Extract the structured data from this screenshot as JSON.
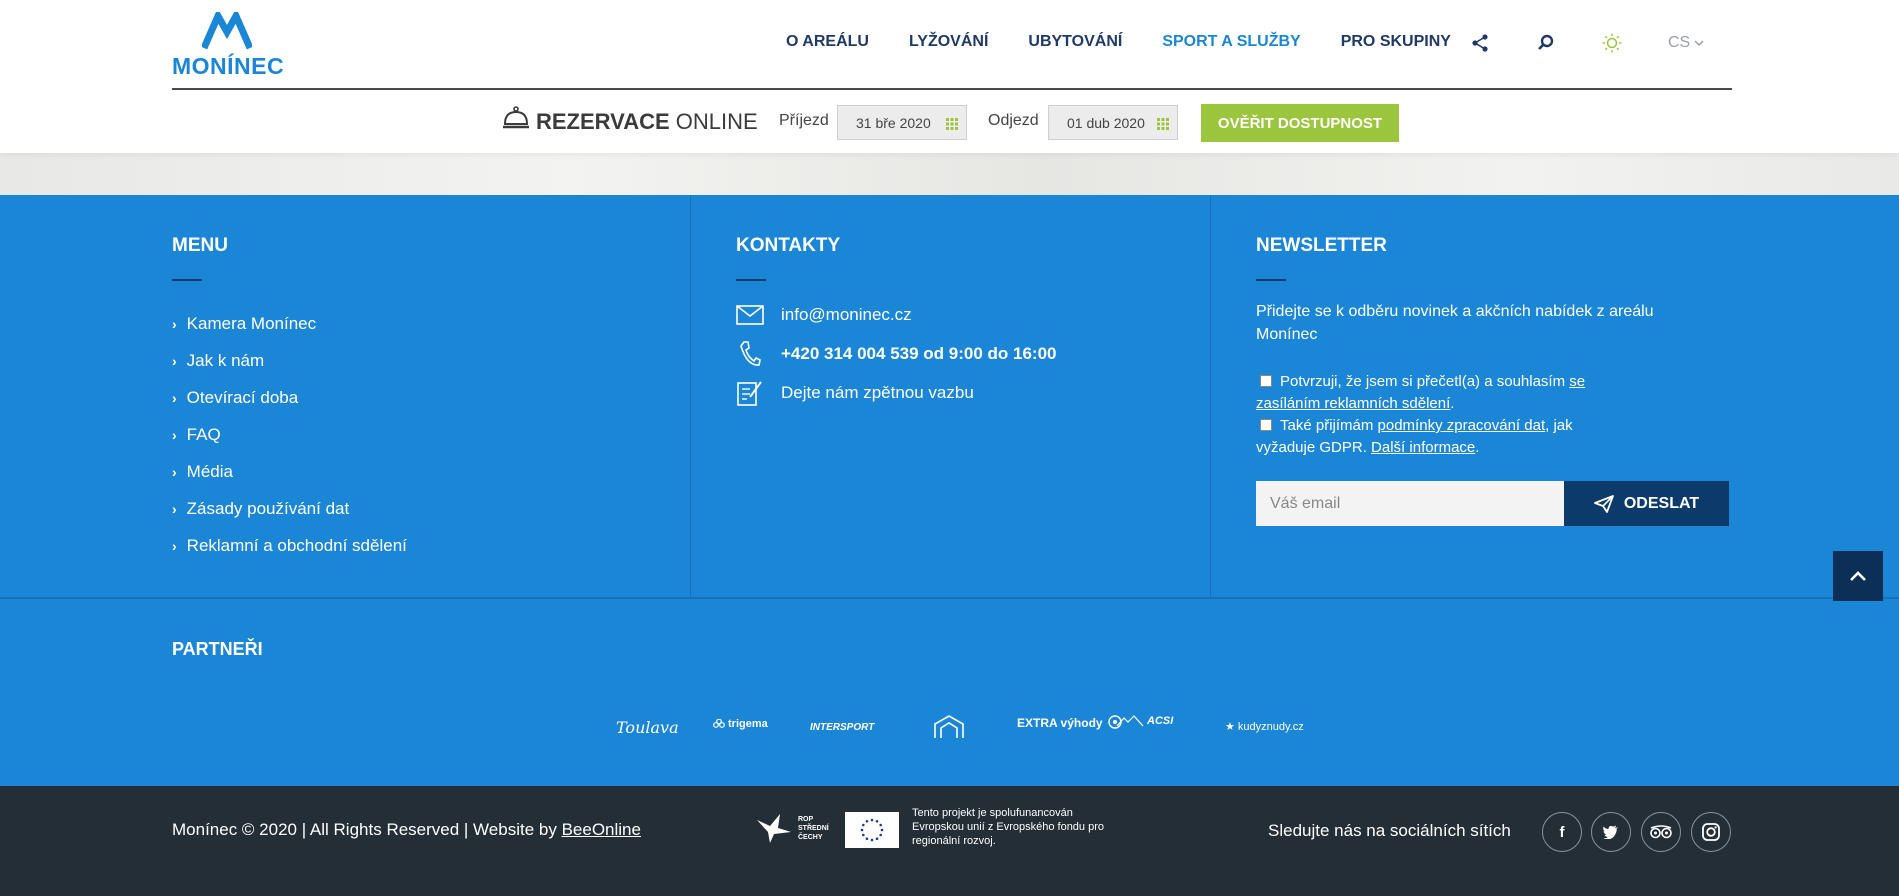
{
  "header": {
    "logo_text": "MONÍNEC",
    "nav": [
      "O AREÁLU",
      "LYŽOVÁNÍ",
      "UBYTOVÁNÍ",
      "SPORT A SLUŽBY",
      "PRO SKUPINY"
    ],
    "active_nav": "SPORT A SLUŽBY",
    "icons": [
      "share-icon",
      "search-icon",
      "sun-icon"
    ],
    "language": "CS"
  },
  "booking": {
    "title_bold": "REZERVACE",
    "title_light": "ONLINE",
    "arrival_label": "Příjezd",
    "arrival_value": "31 bře 2020",
    "departure_label": "Odjezd",
    "departure_value": "01 dub 2020",
    "check_button": "OVĚŘIT DOSTUPNOST"
  },
  "menu": {
    "title": "MENU",
    "items": [
      "Kamera Monínec",
      "Jak k nám",
      "Otevírací doba",
      "FAQ",
      "Média",
      "Zásady používání dat",
      "Reklamní a obchodní sdělení"
    ]
  },
  "contacts": {
    "title": "KONTAKTY",
    "email": "info@moninec.cz",
    "phone": "+420 314 004 539 od 9:00 do 16:00",
    "feedback": "Dejte nám zpětnou vazbu"
  },
  "newsletter": {
    "title": "NEWSLETTER",
    "intro": "Přidejte se k odběru novinek a akčních nabídek z areálu Monínec",
    "consent1_a": "Potvrzuji, že jsem si přečetl(a) a souhlasím",
    "consent1_link": "se zasíláním reklamních sdělení",
    "consent2_a": "Také přijímám",
    "consent2_link": "podmínky zpracování dat",
    "consent2_b": "jak vyžaduje GDPR.",
    "consent2_more": "Další informace",
    "email_placeholder": "Váš email",
    "send_button": "ODESLAT"
  },
  "partners": {
    "title": "PARTNEŘI",
    "items": [
      "Toulava",
      "trigema",
      "INTERSPORT",
      "",
      "EXTRA výhody",
      "ACSI",
      "kudyznudy.cz"
    ]
  },
  "bottom": {
    "copyright": "Monínec © 2020 | All Rights Reserved | Website by",
    "agency": "BeeOnline",
    "rop_text": "ROP STŘEDNÍ ČECHY",
    "eu_text": "Tento projekt je spolufunancován Evropskou unií z Evropského fondu pro regionální rozvoj.",
    "social_label": "Sledujte nás na sociálních sítích",
    "social": [
      "facebook-icon",
      "twitter-icon",
      "tripadvisor-icon",
      "instagram-icon"
    ]
  },
  "colors": {
    "brand_blue": "#1c86d6",
    "navy": "#0b3a6b",
    "green": "#9bc53d",
    "dark_bar": "#242e36"
  }
}
